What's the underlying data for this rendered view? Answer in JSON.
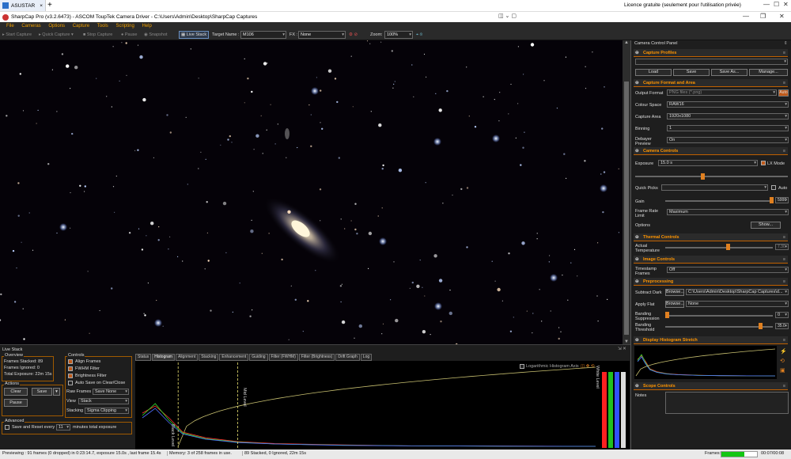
{
  "remote": {
    "tab": "ASUSTAR",
    "close": "×",
    "new_tab": "+",
    "license": "Licence gratuite (seulement pour l'utilisation privée)"
  },
  "window": {
    "title": "SharpCap Pro (v3.2.6473) - ASCOM ToupTek Camera Driver - C:\\Users\\Admin\\Desktop\\SharpCap Captures"
  },
  "menu": [
    "File",
    "Cameras",
    "Options",
    "Capture",
    "Tools",
    "Scripting",
    "Help"
  ],
  "toolbar": {
    "start_capture": "Start Capture",
    "quick_capture": "Quick Capture",
    "stop_capture": "Stop Capture",
    "pause": "Pause",
    "snapshot": "Snapshot",
    "live_stack": "Live Stack",
    "target_name_label": "Target Name :",
    "target_name": "M106",
    "fx_label": "FX :",
    "fx": "None",
    "zoom_label": "Zoom:",
    "zoom": "100%"
  },
  "live_stack": {
    "title": "Live Stack",
    "overview_label": "Overview",
    "frames_stacked": "Frames Stacked: 89",
    "frames_ignored": "Frames Ignored: 0",
    "total_exposure": "Total Exposure: 22m 15s",
    "actions_label": "Actions",
    "clear": "Clear",
    "save": "Save",
    "pause": "Pause",
    "advanced_label": "Advanced",
    "save_reset_prefix": "Save and Reset every",
    "save_reset_value": "11",
    "save_reset_suffix": "minutes total exposure",
    "controls_label": "Controls",
    "align_frames": "Align Frames",
    "fwhm_filter": "FWHM Filter",
    "brightness_filter": "Brightness Filter",
    "auto_save": "Auto Save on Clear/Close",
    "raw_frames_label": "Raw Frames",
    "raw_frames": "Save None",
    "view_label": "View",
    "view": "Stack",
    "stacking_label": "Stacking",
    "stacking": "Sigma Clipping",
    "tabs": [
      "Status",
      "Histogram",
      "Alignment",
      "Stacking",
      "Enhancement",
      "Guiding",
      "Filter (FWHM)",
      "Filter (Brightness)",
      "Drift Graph",
      "Log"
    ],
    "active_tab": "Histogram",
    "log_axis_label": "Logarithmic Histogram Axis",
    "black_level": "Black Level",
    "mid_level": "Mid Level",
    "white_level": "White Level",
    "levels_histogram": {
      "x_fraction": [
        0.012,
        0.04,
        0.07,
        0.1,
        0.15,
        0.22,
        0.3,
        0.45,
        0.6,
        0.8,
        1.0
      ],
      "red": [
        0.7,
        0.85,
        0.6,
        0.3,
        0.18,
        0.1,
        0.06,
        0.03,
        0.01,
        0.005,
        0
      ],
      "green": [
        0.65,
        0.9,
        0.55,
        0.28,
        0.16,
        0.09,
        0.05,
        0.025,
        0.01,
        0.004,
        0
      ],
      "blue": [
        0.6,
        0.8,
        0.5,
        0.26,
        0.15,
        0.08,
        0.05,
        0.02,
        0.01,
        0.004,
        0
      ],
      "black_level": 0.09,
      "mid_level": 0.22
    }
  },
  "status": {
    "previewing": "Previewing : 91 frames (0 dropped) in 0:23:14.7, exposure 15.0s , last frame 15.4s",
    "memory": "Memory: 3 of 258 frames in use.",
    "stack": "89 Stacked, 0 Ignored, 22m 15s",
    "frames_label": "Frames:",
    "frames_progress": 0.65,
    "time": "00:07/00:08"
  },
  "panel": {
    "title": "Camera Control Panel",
    "capture_profiles": "Capture Profiles",
    "load": "Load",
    "save": "Save",
    "save_as": "Save As...",
    "manage": "Manage...",
    "capture_format": "Capture Format and Area",
    "output_format_label": "Output Format",
    "output_format": "PNG files (*.png)",
    "auto": "Auto",
    "colour_space_label": "Colour Space",
    "colour_space": "RAW16",
    "capture_area_label": "Capture Area",
    "capture_area": "1920x1080",
    "binning_label": "Binning",
    "binning": "1",
    "debayer_label": "Debayer Preview",
    "debayer": "On",
    "camera_controls": "Camera Controls",
    "exposure_label": "Exposure",
    "exposure": "15.0 s",
    "lx_mode": "LX Mode",
    "quick_picks_label": "Quick Picks",
    "auto2": "Auto",
    "gain_label": "Gain",
    "gain": "5000",
    "gain_level": 1.0,
    "frame_rate_label": "Frame Rate Limit",
    "frame_rate": "Maximum",
    "options_label": "Options",
    "show": "Show...",
    "thermal": "Thermal Controls",
    "actual_temp_label": "Actual Temperature",
    "actual_temp": "7.30",
    "image_controls": "Image Controls",
    "timestamp_label": "Timestamp Frames",
    "timestamp": "Off",
    "preprocessing": "Preprocessing",
    "subtract_dark_label": "Subtract Dark",
    "browse": "Browse...",
    "dark_path": "C:\\Users\\Admin\\Desktop\\SharpCap Captures\\d...",
    "apply_flat_label": "Apply Flat",
    "flat": "None",
    "banding_supp_label": "Banding Suppression",
    "banding_supp": "0",
    "banding_thr_label": "Banding Threshold",
    "banding_thr": "35.0",
    "display_stretch": "Display Histogram Stretch",
    "scope_controls": "Scope Controls",
    "notes_label": "Notes"
  },
  "colors": {
    "accent": "#ff9500",
    "bg": "#1e1e1e",
    "active": "#c05a1a"
  }
}
